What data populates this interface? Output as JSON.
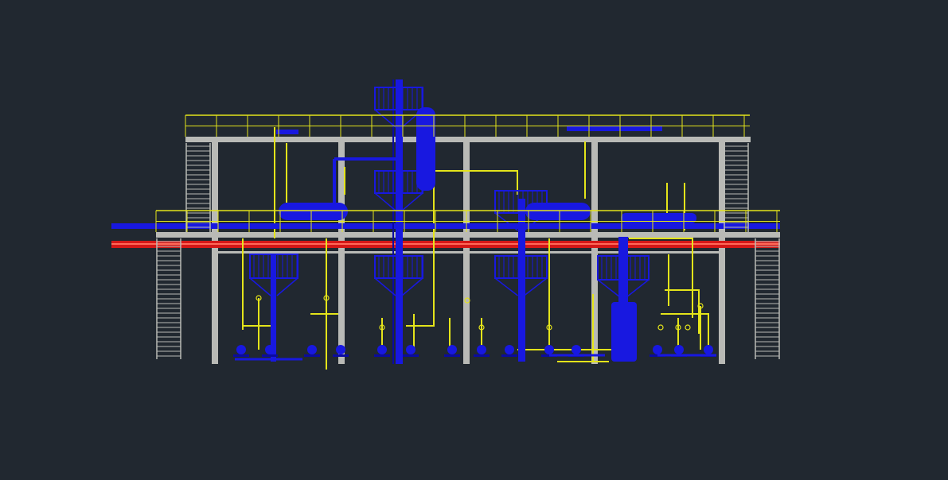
{
  "viewport": {
    "background": "#212830"
  },
  "drawing": {
    "colors": {
      "structure": "#b9bab6",
      "equipment": "#1818e0",
      "equipment_dark": "#0a0aa0",
      "piping": "#e4e41a",
      "steam_line": "#d41818",
      "steam_line_hi": "#ff6a5a"
    },
    "icons": [
      "cad-plant-elevation-drawing"
    ]
  }
}
